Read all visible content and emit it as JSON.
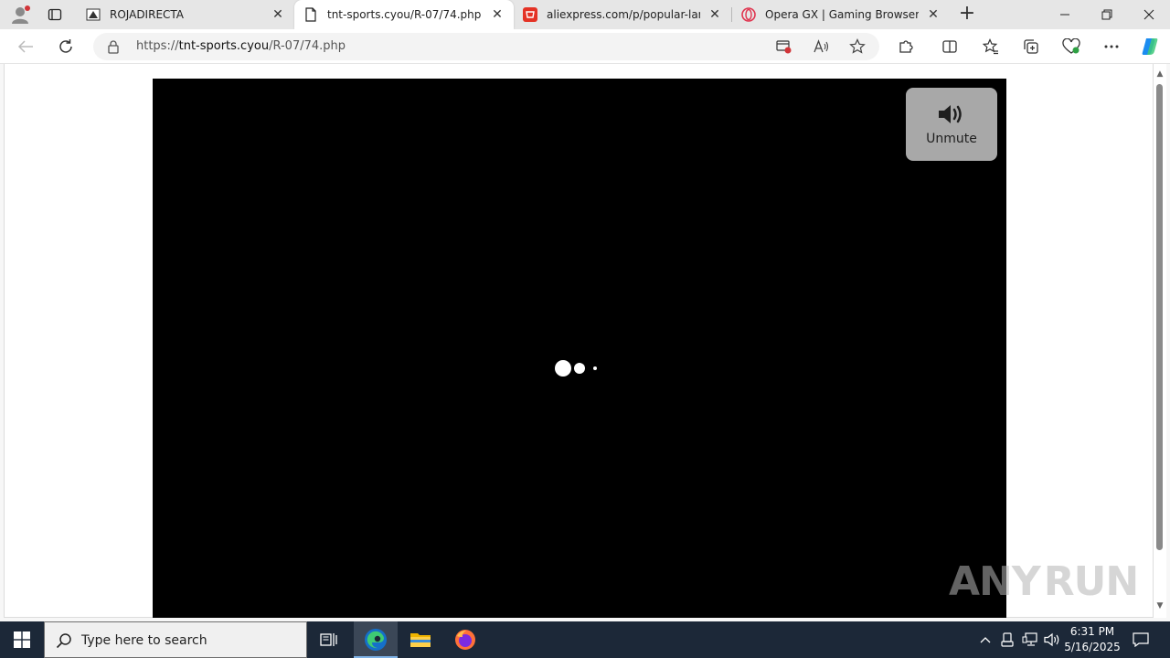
{
  "tabs": [
    {
      "title": "ROJADIRECTA",
      "favicon": "rojadirecta-favicon",
      "active": false
    },
    {
      "title": "tnt-sports.cyou/R-07/74.php",
      "favicon": "page-icon",
      "active": true
    },
    {
      "title": "aliexpress.com/p/popular-landin",
      "favicon": "aliexpress-favicon",
      "active": false
    },
    {
      "title": "Opera GX | Gaming Browser | Op",
      "favicon": "opera-favicon",
      "active": false
    }
  ],
  "address_bar": {
    "scheme": "https://",
    "host": "tnt-sports.cyou",
    "path": "/R-07/74.php"
  },
  "player": {
    "unmute_label": "Unmute"
  },
  "watermark": {
    "left_text": "ANY",
    "right_text": "RUN"
  },
  "taskbar": {
    "search_placeholder": "Type here to search",
    "time": "6:31 PM",
    "date": "5/16/2025"
  },
  "colors": {
    "accent_taskbar": "#1c2838",
    "player_bg": "#000000",
    "unmute_bg": "#a8a8a8"
  }
}
